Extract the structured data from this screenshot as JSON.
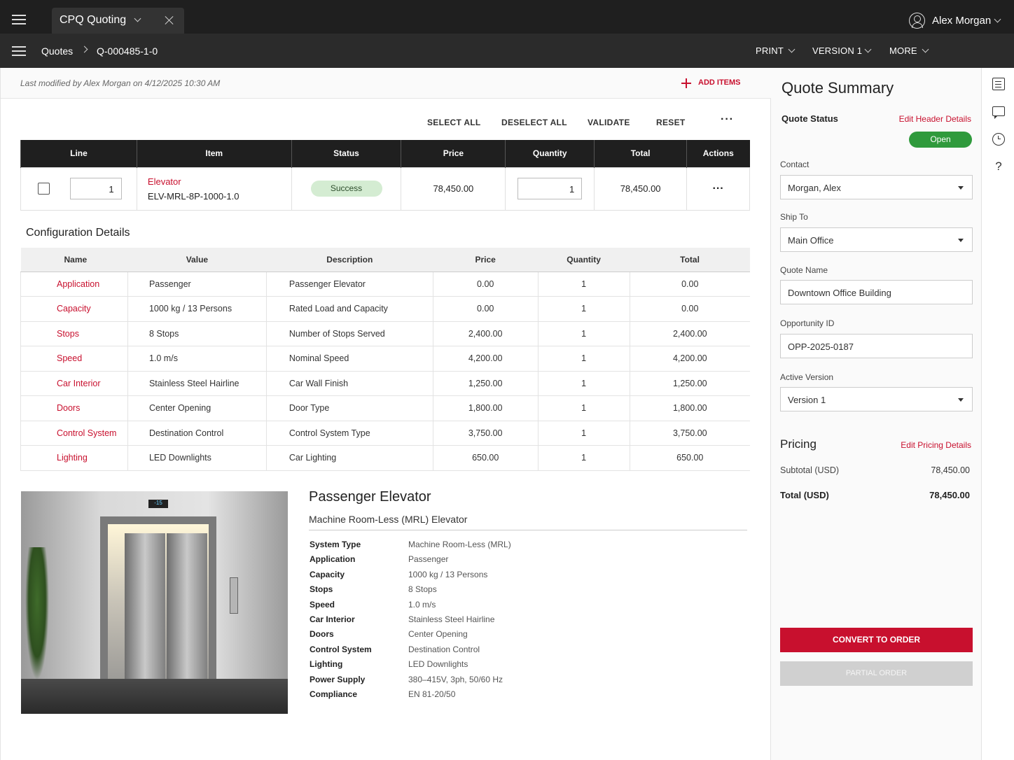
{
  "app_tab": {
    "title": "CPQ Quoting"
  },
  "user": {
    "name": "Alex Morgan"
  },
  "breadcrumb": {
    "root": "Quotes",
    "current": "Q-000485-1-0"
  },
  "nav_menus": {
    "print": "PRINT",
    "version": "VERSION 1",
    "more": "MORE"
  },
  "modified": "Last modified by Alex Morgan on 4/12/2025 10:30 AM",
  "add_items": "ADD ITEMS",
  "toolbar": {
    "select_all": "SELECT ALL",
    "deselect_all": "DESELECT ALL",
    "validate": "VALIDATE",
    "reset": "RESET"
  },
  "line_table": {
    "headers": [
      "Line",
      "Item",
      "Status",
      "Price",
      "Quantity",
      "Total",
      "Actions"
    ],
    "rows": [
      {
        "line": "1",
        "item_name": "Elevator",
        "item_code": "ELV-MRL-8P-1000-1.0",
        "status": "Success",
        "price": "78,450.00",
        "quantity": "1",
        "total": "78,450.00"
      }
    ]
  },
  "config": {
    "title": "Configuration Details",
    "headers": [
      "Name",
      "Value",
      "Description",
      "Price",
      "Quantity",
      "Total"
    ],
    "rows": [
      [
        "Application",
        "Passenger",
        "Passenger Elevator",
        "0.00",
        "1",
        "0.00"
      ],
      [
        "Capacity",
        "1000 kg / 13 Persons",
        "Rated Load and Capacity",
        "0.00",
        "1",
        "0.00"
      ],
      [
        "Stops",
        "8 Stops",
        "Number of Stops Served",
        "2,400.00",
        "1",
        "2,400.00"
      ],
      [
        "Speed",
        "1.0 m/s",
        "Nominal Speed",
        "4,200.00",
        "1",
        "4,200.00"
      ],
      [
        "Car Interior",
        "Stainless Steel Hairline",
        "Car Wall Finish",
        "1,250.00",
        "1",
        "1,250.00"
      ],
      [
        "Doors",
        "Center Opening",
        "Door Type",
        "1,800.00",
        "1",
        "1,800.00"
      ],
      [
        "Control System",
        "Destination Control",
        "Control System Type",
        "3,750.00",
        "1",
        "3,750.00"
      ],
      [
        "Lighting",
        "LED Downlights",
        "Car Lighting",
        "650.00",
        "1",
        "650.00"
      ]
    ]
  },
  "product": {
    "title": "Passenger Elevator",
    "subtitle": "Machine Room-Less (MRL) Elevator",
    "display": "-15",
    "specs": [
      [
        "System Type",
        "Machine Room-Less (MRL)"
      ],
      [
        "Application",
        "Passenger"
      ],
      [
        "Capacity",
        "1000 kg / 13 Persons"
      ],
      [
        "Stops",
        "8 Stops"
      ],
      [
        "Speed",
        "1.0 m/s"
      ],
      [
        "Car Interior",
        "Stainless Steel Hairline"
      ],
      [
        "Doors",
        "Center Opening"
      ],
      [
        "Control System",
        "Destination Control"
      ],
      [
        "Lighting",
        "LED Downlights"
      ],
      [
        "Power Supply",
        "380–415V, 3ph, 50/60 Hz"
      ],
      [
        "Compliance",
        "EN 81-20/50"
      ]
    ]
  },
  "summary": {
    "title": "Quote Summary",
    "status_label": "Quote Status",
    "edit_header": "Edit Header Details",
    "status": "Open",
    "contact_label": "Contact",
    "contact": "Morgan, Alex",
    "ship_label": "Ship To",
    "ship": "Main Office",
    "name_label": "Quote Name",
    "name": "Downtown Office Building",
    "opp_label": "Opportunity ID",
    "opp": "OPP-2025-0187",
    "ver_label": "Active Version",
    "ver": "Version 1",
    "pricing_label": "Pricing",
    "edit_pricing": "Edit Pricing Details",
    "subtotal_label": "Subtotal (USD)",
    "subtotal": "78,450.00",
    "total_label": "Total (USD)",
    "total": "78,450.00",
    "convert": "CONVERT TO ORDER",
    "partial": "PARTIAL ORDER"
  },
  "colors": {
    "accent": "#c8102e",
    "success": "#2f9a3c"
  }
}
